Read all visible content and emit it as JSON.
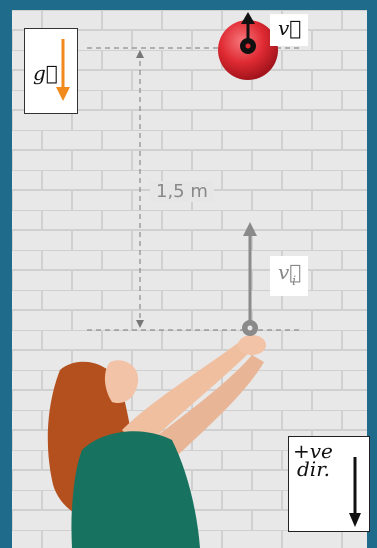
{
  "labels": {
    "gravity": "g⃗",
    "velocity": "v⃗",
    "initial_velocity": "v⃗",
    "initial_velocity_subscript": "i",
    "distance": "1,5 m",
    "positive_direction_line1": "+ve",
    "positive_direction_line2": "dir."
  },
  "colors": {
    "background_frame": "#1e6b8c",
    "wall": "#e6e6e6",
    "ball": "#e02b33",
    "gravity_arrow": "#f08a1d",
    "vi_arrow": "#8a8a8a",
    "dashed_line": "#777777"
  }
}
